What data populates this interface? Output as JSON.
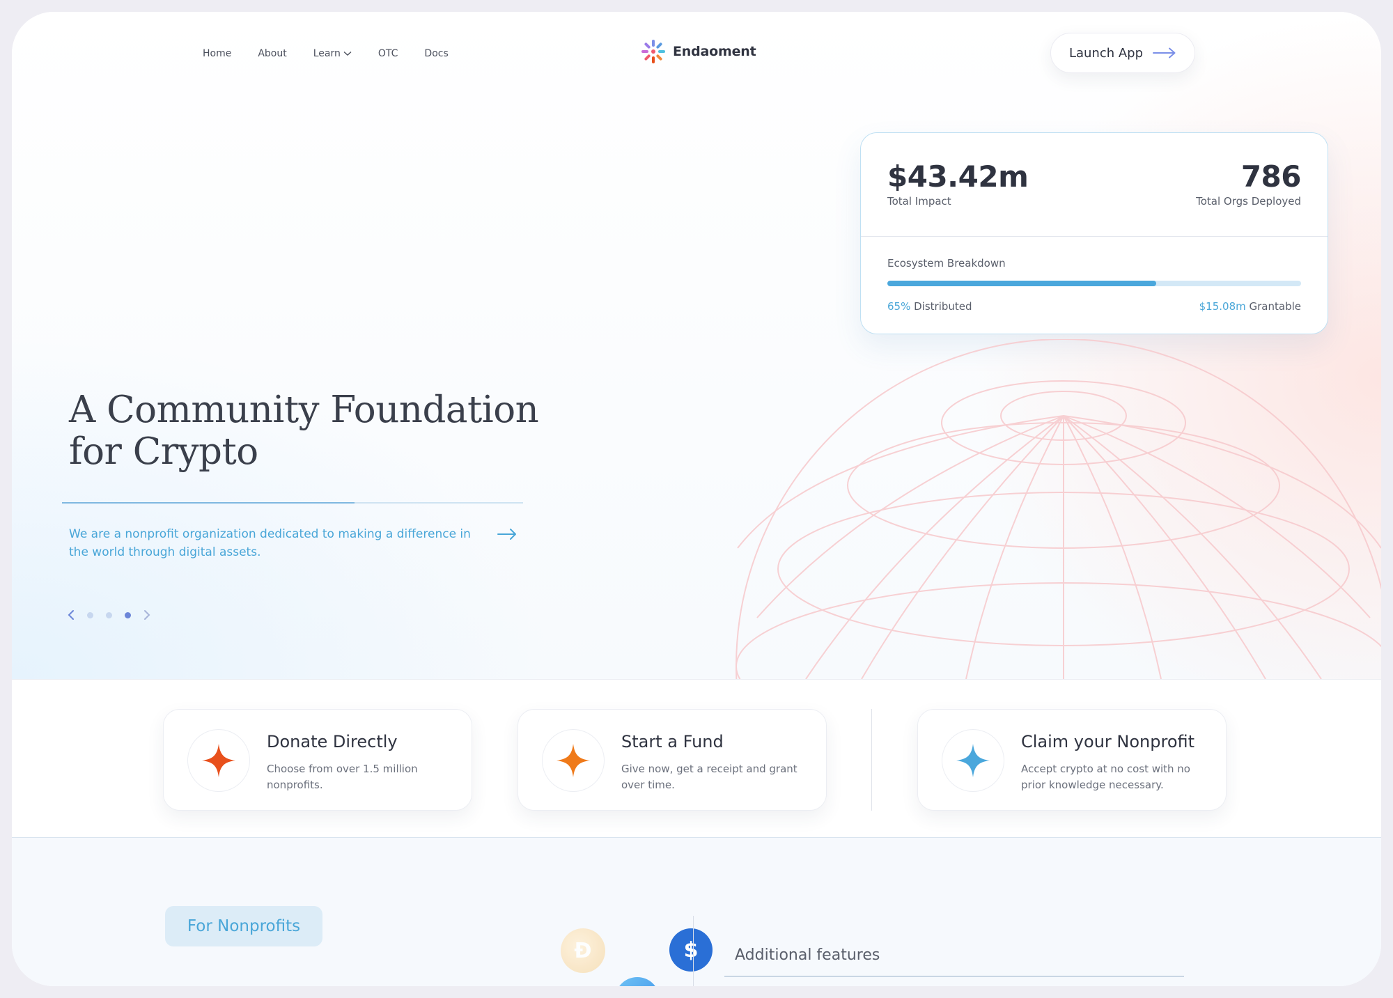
{
  "nav": {
    "items": [
      {
        "label": "Home"
      },
      {
        "label": "About"
      },
      {
        "label": "Learn",
        "has_dropdown": true
      },
      {
        "label": "OTC"
      },
      {
        "label": "Docs"
      }
    ]
  },
  "brand": {
    "name": "Endaoment"
  },
  "header": {
    "launch_label": "Launch App"
  },
  "stats": {
    "impact_value": "$43.42m",
    "impact_label": "Total Impact",
    "orgs_value": "786",
    "orgs_label": "Total Orgs Deployed",
    "breakdown_title": "Ecosystem Breakdown",
    "distributed_percent": "65%",
    "distributed_label": "Distributed",
    "distributed_fraction": 0.65,
    "grantable_value": "$15.08m",
    "grantable_label": "Grantable"
  },
  "hero": {
    "headline_line1": "A Community Foundation",
    "headline_line2": "for Crypto",
    "tagline": "We are a nonprofit organization dedicated to making a difference in the world through digital assets.",
    "slide_count": 3,
    "active_slide": 3
  },
  "actions": [
    {
      "title": "Donate Directly",
      "desc": "Choose from over 1.5 million nonprofits.",
      "icon": "sparkle-icon",
      "color": "#e8501c"
    },
    {
      "title": "Start a Fund",
      "desc": "Give now, get a receipt and grant over time.",
      "icon": "sparkle-icon",
      "color": "#ef7a1a"
    },
    {
      "title": "Claim your Nonprofit",
      "desc": "Accept crypto at no cost with no prior knowledge necessary.",
      "icon": "sparkle-icon",
      "color": "#4aa7dc"
    }
  ],
  "bottom": {
    "pill_label": "For Nonprofits",
    "features_label": "Additional features"
  },
  "colors": {
    "accent": "#49a6d8",
    "text": "#2f3340"
  }
}
